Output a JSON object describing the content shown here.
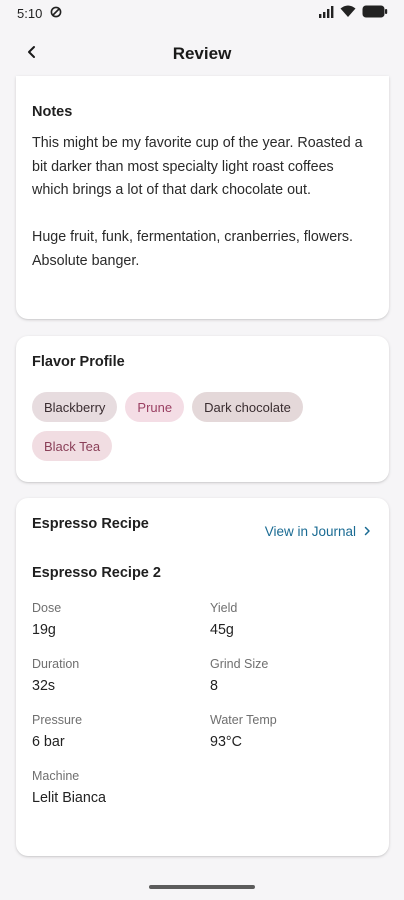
{
  "status_bar": {
    "time": "5:10"
  },
  "app_bar": {
    "title": "Review"
  },
  "notes": {
    "title": "Notes",
    "paragraphs": [
      "This might be my favorite cup of the year. Roasted a bit darker than most specialty light roast coffees which brings a lot of that dark chocolate out.",
      "Huge fruit, funk, fermentation, cranberries, flowers.  Absolute banger."
    ]
  },
  "flavor_profile": {
    "title": "Flavor Profile",
    "chips": [
      "Blackberry",
      "Prune",
      "Dark chocolate",
      "Black Tea"
    ]
  },
  "recipe": {
    "section_title": "Espresso Recipe",
    "link_label": "View in Journal",
    "name": "Espresso Recipe 2",
    "fields": {
      "dose": {
        "label": "Dose",
        "value": "19g"
      },
      "yield": {
        "label": "Yield",
        "value": "45g"
      },
      "duration": {
        "label": "Duration",
        "value": "32s"
      },
      "grind_size": {
        "label": "Grind Size",
        "value": "8"
      },
      "pressure": {
        "label": "Pressure",
        "value": "6 bar"
      },
      "water_temp": {
        "label": "Water Temp",
        "value": "93°C"
      },
      "machine": {
        "label": "Machine",
        "value": "Lelit Bianca"
      }
    }
  },
  "icons": {
    "status_left": [
      "do-not-disturb-icon"
    ],
    "status_right": [
      "signal-icon",
      "wifi-icon",
      "battery-icon"
    ],
    "back": "back-arrow-icon",
    "link": "chevron-right-icon"
  },
  "colors": {
    "background": "#f6f5f7",
    "card": "#ffffff",
    "link": "#1a6b93",
    "chip_pink_text": "#9a3f62"
  }
}
